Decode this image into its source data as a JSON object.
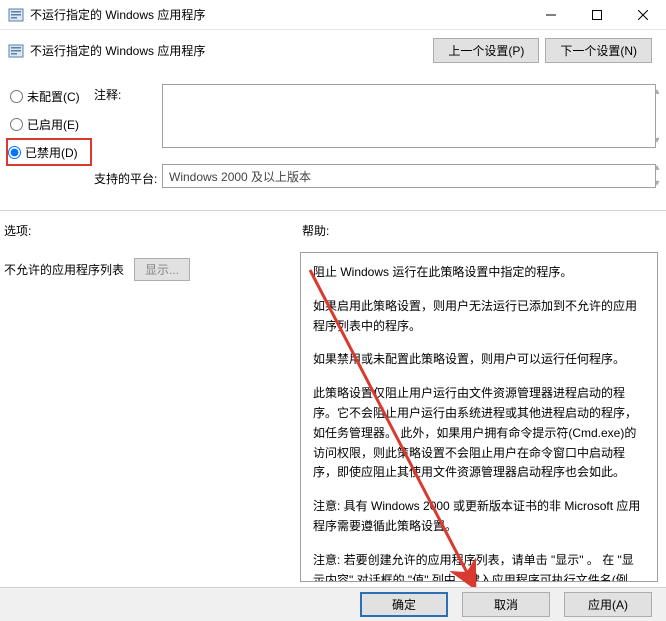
{
  "window": {
    "title": "不运行指定的 Windows 应用程序",
    "subtitle": "不运行指定的 Windows 应用程序",
    "prev_setting": "上一个设置(P)",
    "next_setting": "下一个设置(N)"
  },
  "radios": {
    "not_configured": "未配置(C)",
    "enabled": "已启用(E)",
    "disabled": "已禁用(D)",
    "selected": "disabled"
  },
  "labels": {
    "comment": "注释:",
    "platform": "支持的平台:",
    "options": "选项:",
    "help": "帮助:",
    "disallowed_apps": "不允许的应用程序列表",
    "show": "显示..."
  },
  "platform_text": "Windows 2000 及以上版本",
  "help_text": {
    "p1": "阻止 Windows 运行在此策略设置中指定的程序。",
    "p2": "如果启用此策略设置，则用户无法运行已添加到不允许的应用程序列表中的程序。",
    "p3": "如果禁用或未配置此策略设置，则用户可以运行任何程序。",
    "p4": "此策略设置仅阻止用户运行由文件资源管理器进程启动的程序。它不会阻止用户运行由系统进程或其他进程启动的程序，如任务管理器。 此外，如果用户拥有命令提示符(Cmd.exe)的访问权限，则此策略设置不会阻止用户在命令窗口中启动程序，即使应阻止其使用文件资源管理器启动程序也会如此。",
    "p5": "注意: 具有 Windows 2000 或更新版本证书的非 Microsoft 应用程序需要遵循此策略设置。",
    "p6": "注意: 若要创建允许的应用程序列表，请单击 \"显示\" 。 在 \"显示内容\" 对话框的 \"值\" 列中，键入应用程序可执行文件名(例如，Winword.exe、Poledit.exe 和 Powerpnt.exe)。"
  },
  "buttons": {
    "ok": "确定",
    "cancel": "取消",
    "apply": "应用(A)"
  }
}
